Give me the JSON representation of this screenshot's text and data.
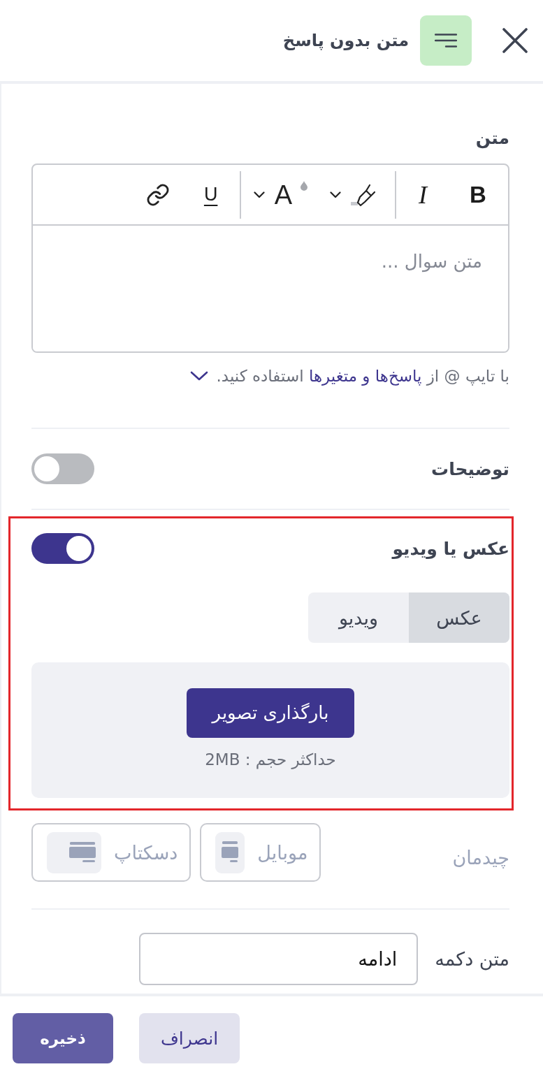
{
  "header": {
    "title": "متن بدون پاسخ"
  },
  "text_field": {
    "label": "متن",
    "toolbar": [
      {
        "kind": "bold",
        "label": "B"
      },
      {
        "kind": "italic",
        "label": "I"
      },
      {
        "kind": "separator"
      },
      {
        "kind": "highlight"
      },
      {
        "kind": "text_color",
        "label": "A"
      },
      {
        "kind": "separator"
      },
      {
        "kind": "underline",
        "label": "U"
      },
      {
        "kind": "link"
      }
    ],
    "placeholder": "متن سوال ...",
    "hint": {
      "before": "با تایپ @ از",
      "link": "پاسخ‌ها و متغیرها",
      "after": "استفاده کنید."
    }
  },
  "description": {
    "label": "توضیحات",
    "on": false
  },
  "media": {
    "label": "عکس یا ویدیو",
    "on": true,
    "highlighted": true,
    "tabs": [
      {
        "label": "عکس",
        "selected": true
      },
      {
        "label": "ویدیو",
        "selected": false
      }
    ],
    "upload_button": "بارگذاری تصویر",
    "size_note": "حداکثر حجم : 2MB"
  },
  "layout": {
    "label": "چیدمان",
    "options": [
      {
        "kind": "mobile",
        "label": "موبایل",
        "selected": false
      },
      {
        "kind": "desktop",
        "label": "دسکتاپ",
        "selected": false
      }
    ]
  },
  "button_text": {
    "label": "متن دکمه",
    "value": "ادامه"
  },
  "footer": {
    "buttons": [
      {
        "kind": "secondary",
        "label": "انصراف"
      },
      {
        "kind": "primary",
        "label": "ذخیره"
      }
    ]
  }
}
